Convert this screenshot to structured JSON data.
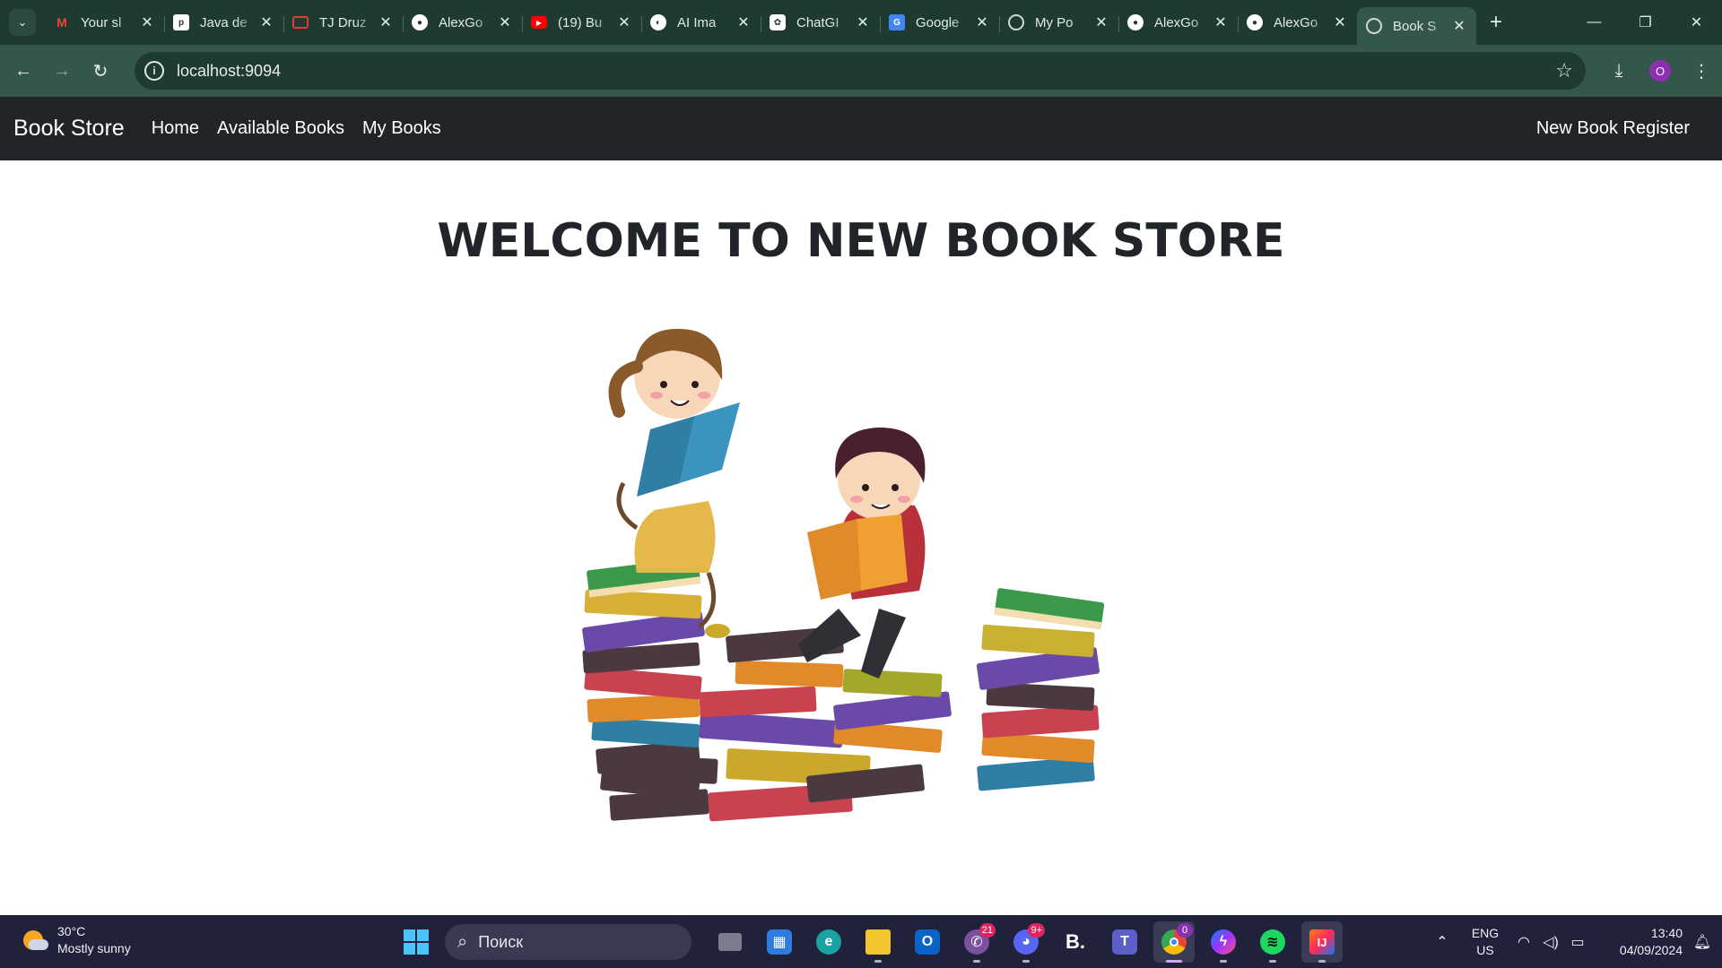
{
  "browser": {
    "tabs": [
      {
        "title": "Your sl",
        "favicon": "gmail-icon",
        "color": "#ea4335"
      },
      {
        "title": "Java de",
        "favicon": "p-icon",
        "color": "#ffffff"
      },
      {
        "title": "TJ Druz",
        "favicon": "tj-icon",
        "color": "#e53935"
      },
      {
        "title": "AlexGo",
        "favicon": "github-icon",
        "color": "#ffffff"
      },
      {
        "title": "(19) Bu",
        "favicon": "youtube-icon",
        "color": "#ff0000"
      },
      {
        "title": "AI Ima",
        "favicon": "ai-icon",
        "color": "#ffffff"
      },
      {
        "title": "ChatGI",
        "favicon": "chatgpt-icon",
        "color": "#ffffff"
      },
      {
        "title": "Google",
        "favicon": "google-translate-icon",
        "color": "#4285f4"
      },
      {
        "title": "My Po",
        "favicon": "globe-icon",
        "color": "#cfd8d3"
      },
      {
        "title": "AlexGo",
        "favicon": "github-icon",
        "color": "#ffffff"
      },
      {
        "title": "AlexGo",
        "favicon": "github-icon",
        "color": "#ffffff"
      },
      {
        "title": "Book S",
        "favicon": "globe-icon",
        "color": "#cfd8d3",
        "active": true
      }
    ],
    "url": "localhost:9094",
    "profile_initial": "O"
  },
  "navbar": {
    "brand": "Book Store",
    "links": [
      "Home",
      "Available Books",
      "My Books"
    ],
    "right_link": "New Book Register"
  },
  "main": {
    "heading": "WELCOME TO NEW BOOK STORE",
    "hero_image": "kids-reading-on-books-illustration"
  },
  "taskbar": {
    "weather": {
      "temp": "30°C",
      "desc": "Mostly sunny"
    },
    "search_placeholder": "Поиск",
    "apps": [
      {
        "name": "windows-start-icon"
      },
      {
        "name": "task-view-icon"
      },
      {
        "name": "microsoft-store-icon"
      },
      {
        "name": "edge-icon"
      },
      {
        "name": "file-explorer-icon"
      },
      {
        "name": "outlook-icon"
      },
      {
        "name": "viber-icon",
        "badge": "21"
      },
      {
        "name": "discord-icon",
        "badge": "9+"
      },
      {
        "name": "booking-icon"
      },
      {
        "name": "teams-icon"
      },
      {
        "name": "chrome-icon",
        "badge": "0"
      },
      {
        "name": "messenger-icon"
      },
      {
        "name": "spotify-icon"
      },
      {
        "name": "intellij-icon"
      }
    ],
    "lang": {
      "line1": "ENG",
      "line2": "US"
    },
    "time": "13:40",
    "date": "04/09/2024"
  }
}
